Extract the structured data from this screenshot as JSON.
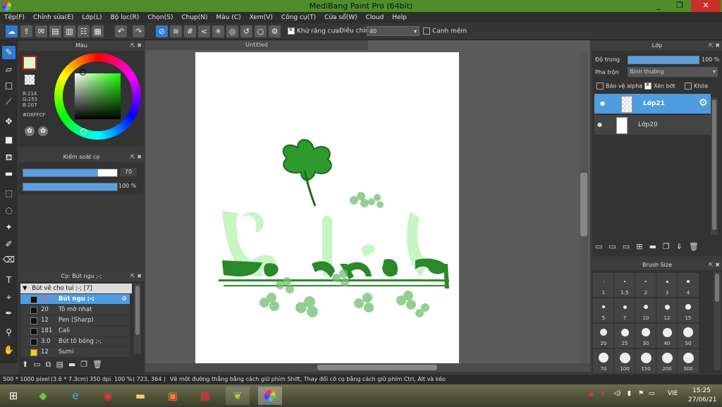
{
  "window": {
    "title": "MediBang Paint Pro (64bit)",
    "minimize": "_",
    "maximize": "❐",
    "close": "✕"
  },
  "menu": [
    "Tệp(F)",
    "Chỉnh sửa(E)",
    "Lớp(L)",
    "Bộ lọc(R)",
    "Chọn(S)",
    "Chụp(N)",
    "Màu (C)",
    "Xem(V)",
    "Công cụ(T)",
    "Cửa sổ(W)",
    "Cloud",
    "Help"
  ],
  "toolbar": {
    "antialias_label": "Khử răng cưa",
    "adjust_label": "Điều chỉnh",
    "adjust_value": "40",
    "snap_label": "Canh mềm"
  },
  "color_panel": {
    "title": "Màu",
    "r": "R:214",
    "g": "G:255",
    "b": "B:207",
    "hex": "#D6FFCF",
    "fg_color": "#d6ffcf"
  },
  "brush_control": {
    "title": "Kiểm soát cọ",
    "size_value": "70",
    "opacity_value": "100 %",
    "size_fraction": 0.8,
    "opacity_fraction": 1.0
  },
  "brush_panel": {
    "title": "Cọ: Bút ngu ;-;",
    "group": "Bút vẽ cho tui ;-; [7]",
    "items": [
      {
        "size": "70",
        "name": "Bút ngu ;-;",
        "selected": true,
        "swatch": "#111111"
      },
      {
        "size": "20",
        "name": "Tô mờ nhạt",
        "selected": false,
        "swatch": "#111111"
      },
      {
        "size": "12",
        "name": "Pen (Sharp)",
        "selected": false,
        "swatch": "#111111"
      },
      {
        "size": "181",
        "name": "Cali",
        "selected": false,
        "swatch": "#111111"
      },
      {
        "size": "3.0",
        "name": "Bút tô bóng ;-;",
        "selected": false,
        "swatch": "#111111"
      },
      {
        "size": "12",
        "name": "Sumi",
        "selected": false,
        "swatch": "#e8d51e"
      }
    ]
  },
  "document": {
    "tab_title": "Untitled"
  },
  "layer_panel": {
    "title": "Lớp",
    "opacity_label": "Độ trong",
    "opacity_value": "100 %",
    "blend_label": "Pha trộn",
    "blend_value": "Bình thường",
    "protect_alpha": "Bảo vệ alpha",
    "clipping": "Xén bớt",
    "lock": "Khóa",
    "layers": [
      {
        "name": "Lớp21",
        "selected": true
      },
      {
        "name": "Lớp20",
        "selected": false
      }
    ]
  },
  "brush_size_panel": {
    "title": "Brush Size",
    "sizes": [
      "1",
      "1.5",
      "2",
      "3",
      "4",
      "5",
      "7",
      "10",
      "12",
      "15",
      "20",
      "25",
      "30",
      "40",
      "50",
      "70",
      "100",
      "150",
      "200",
      "300"
    ]
  },
  "status": {
    "dims": "500 * 1000 pixel",
    "cm": "(3.6 * 7.3cm)",
    "dpi": "350 dpi",
    "zoom": "100 %",
    "coords": "( 723, 364 )",
    "hint": "Vẽ một đường thẳng bằng cách giữ phím Shift, Thay đổi cỡ cọ bằng cách giữ phím Ctrl, Alt và kéo"
  },
  "taskbar": {
    "lang": "VIE",
    "time": "15:25",
    "date": "27/06/21"
  }
}
